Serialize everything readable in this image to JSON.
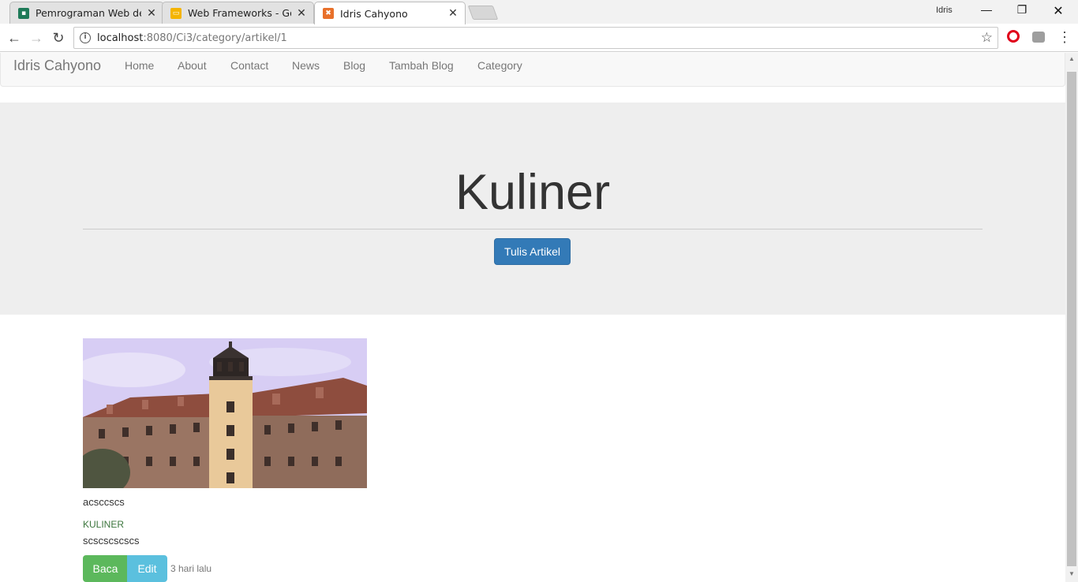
{
  "browser": {
    "tabs": [
      {
        "title": "Pemrograman Web deng",
        "favicon_color": "#1e7a58",
        "active": false
      },
      {
        "title": "Web Frameworks - Goog",
        "favicon_color": "#f4b400",
        "active": false
      },
      {
        "title": "Idris Cahyono",
        "favicon_color": "#e8702a",
        "active": true
      }
    ],
    "profile_name": "Idris",
    "url_host": "localhost",
    "url_path": ":8080/Ci3/category/artikel/1"
  },
  "navbar": {
    "brand": "Idris Cahyono",
    "links": [
      "Home",
      "About",
      "Contact",
      "News",
      "Blog",
      "Tambah Blog",
      "Category"
    ]
  },
  "jumbotron": {
    "heading": "Kuliner",
    "button_label": "Tulis Artikel"
  },
  "article": {
    "title": "acsccscs",
    "category": "KULINER",
    "excerpt": "scscscscscs",
    "read_label": "Baca",
    "edit_label": "Edit",
    "time_ago": "3 hari lalu"
  },
  "colors": {
    "primary": "#337ab7",
    "success": "#5cb85c",
    "info": "#5bc0de",
    "jumbotron_bg": "#eeeeee"
  }
}
